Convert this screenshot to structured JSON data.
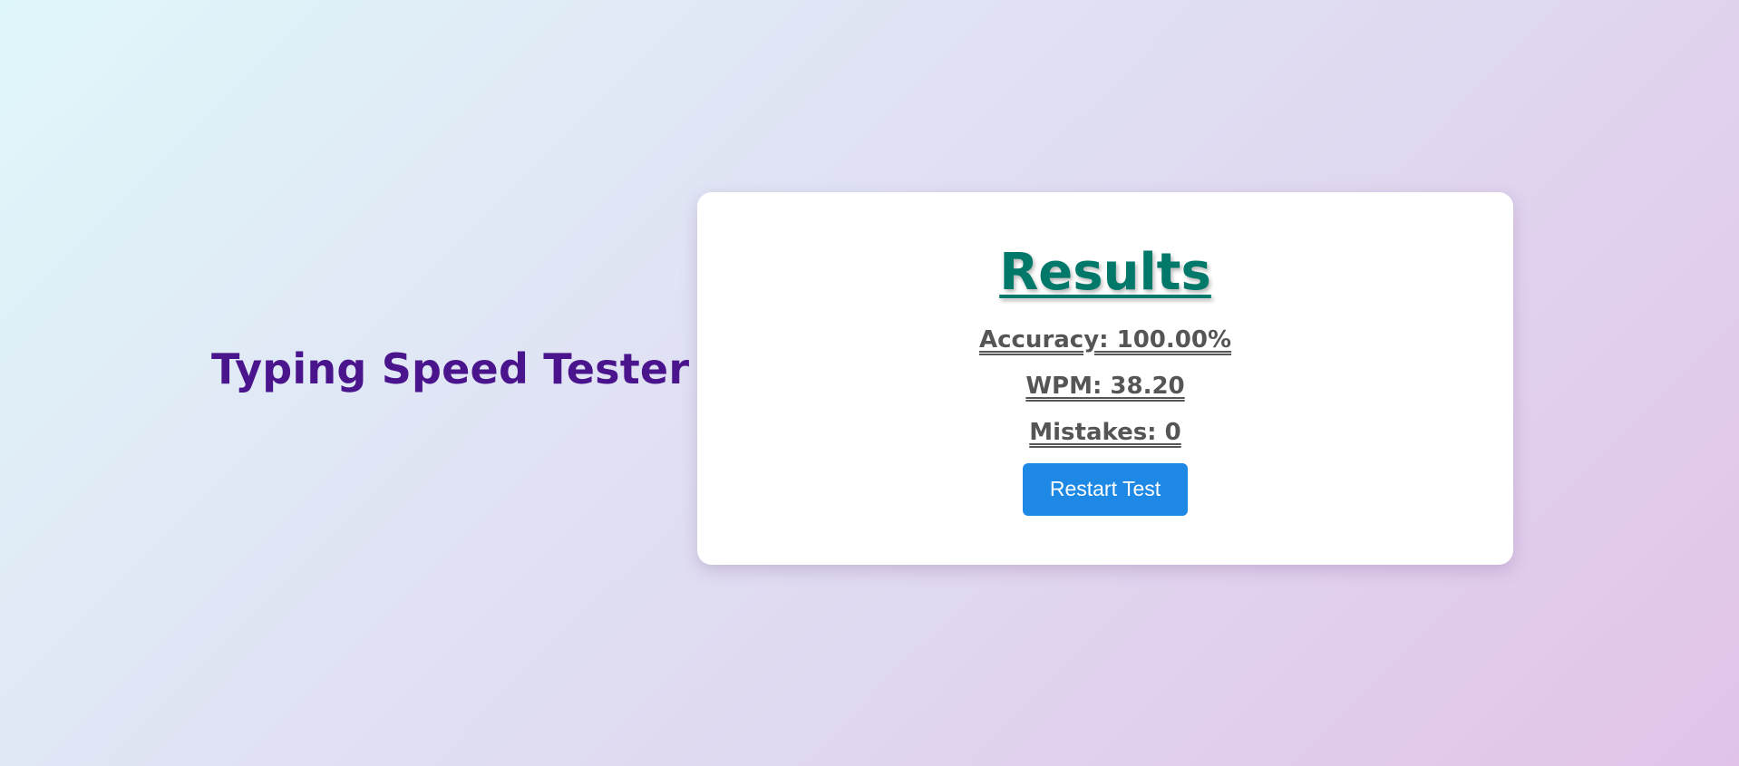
{
  "app": {
    "title": "Typing Speed Tester",
    "icon": "keyboard-icon"
  },
  "results": {
    "heading": "Results",
    "accuracy": "Accuracy: 100.00%",
    "wpm": "WPM: 38.20",
    "mistakes": "Mistakes: 0",
    "restart_label": "Restart Test"
  },
  "colors": {
    "title": "#4a148c",
    "heading": "#00796b",
    "stat_text": "#555555",
    "button": "#1e88e5",
    "background_start": "#e0f7fa",
    "background_end": "#e1c3e9"
  }
}
